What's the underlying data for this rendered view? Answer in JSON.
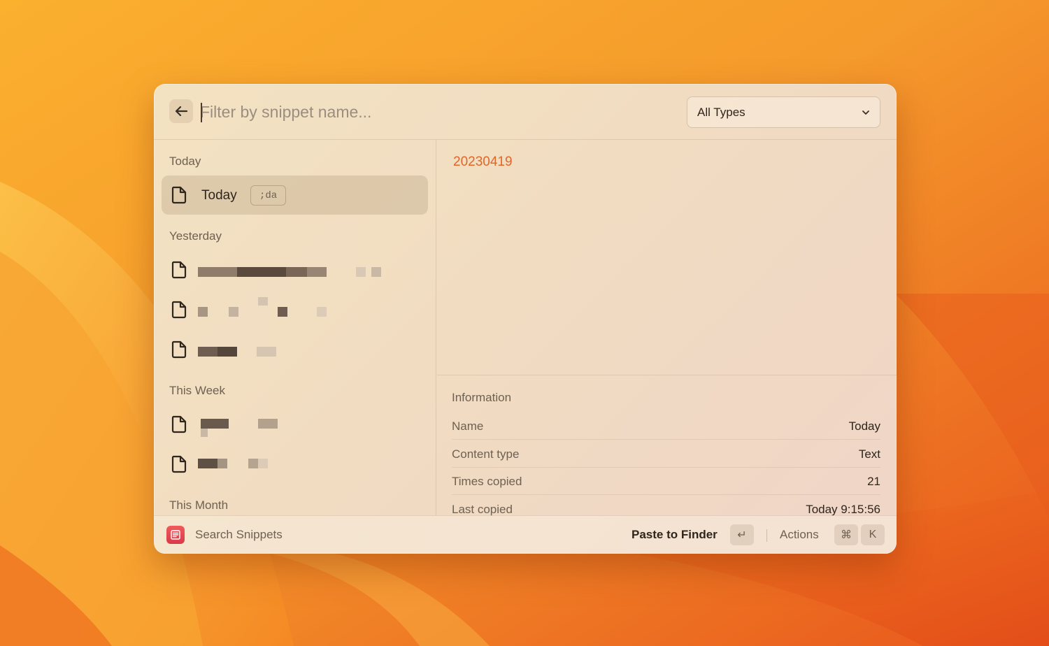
{
  "search": {
    "placeholder": "Filter by snippet name...",
    "value": ""
  },
  "type_filter": {
    "selected": "All Types"
  },
  "sections": {
    "today": "Today",
    "yesterday": "Yesterday",
    "this_week": "This Week",
    "this_month": "This Month"
  },
  "selected_snippet": {
    "name": "Today",
    "keyword": ";da"
  },
  "detail": {
    "content": "20230419"
  },
  "information": {
    "heading": "Information",
    "rows": [
      {
        "key": "Name",
        "value": "Today"
      },
      {
        "key": "Content type",
        "value": "Text"
      },
      {
        "key": "Times copied",
        "value": "21"
      },
      {
        "key": "Last copied",
        "value": "Today 9:15:56"
      }
    ]
  },
  "footer": {
    "title": "Search Snippets",
    "primary_action": "Paste to Finder",
    "primary_shortcut": "↵",
    "actions_label": "Actions",
    "actions_shortcut_mod": "⌘",
    "actions_shortcut_key": "K"
  },
  "colors": {
    "accent_text": "#e0672a",
    "app_icon": "#e24a52"
  },
  "icons": {
    "back": "arrow-left-icon",
    "dropdown": "chevron-down-icon",
    "snippet": "document-icon",
    "app": "snippets-app-icon"
  }
}
